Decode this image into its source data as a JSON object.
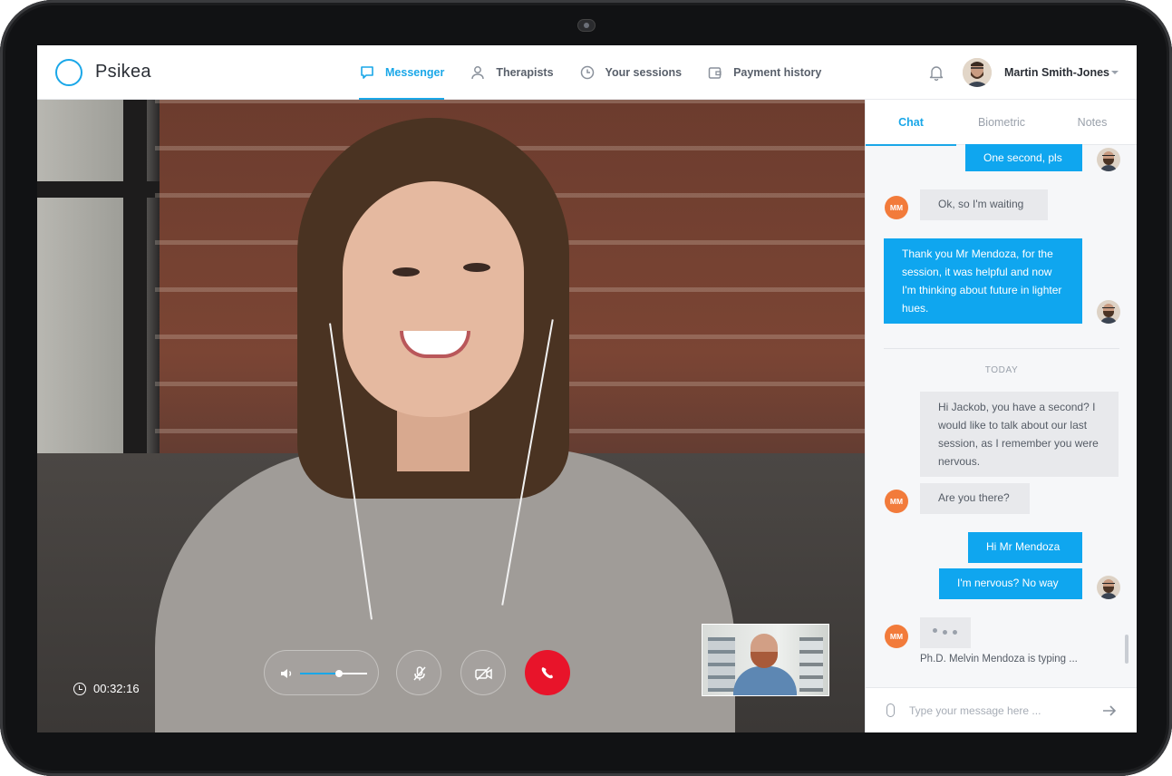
{
  "app": {
    "name": "Psikea"
  },
  "nav": {
    "items": [
      {
        "label": "Messenger",
        "icon": "chat-icon",
        "active": true
      },
      {
        "label": "Therapists",
        "icon": "user-icon",
        "active": false
      },
      {
        "label": "Your sessions",
        "icon": "clock-icon",
        "active": false
      },
      {
        "label": "Payment history",
        "icon": "wallet-icon",
        "active": false
      }
    ]
  },
  "user": {
    "name": "Martin Smith-Jones"
  },
  "call": {
    "timer": "00:32:16",
    "volume_level": 0.58
  },
  "panel": {
    "tabs": [
      "Chat",
      "Biometric",
      "Notes"
    ],
    "active_tab": "Chat",
    "messages": [
      {
        "from": "me",
        "text": "One second, pls"
      },
      {
        "from": "therapist",
        "avatar": "MM",
        "text": "Ok, so I'm waiting"
      },
      {
        "from": "me",
        "text": "Thank you Mr Mendoza, for the session, it was helpful and now I'm thinking about future in lighter hues."
      },
      {
        "from": "therapist",
        "avatar": "MM",
        "text": "Hi Jackob, you have a second? I would like to talk about our last session, as I remember you were nervous."
      },
      {
        "from": "therapist",
        "avatar": "MM",
        "text": "Are you there?"
      },
      {
        "from": "me",
        "text": "Hi Mr Mendoza"
      },
      {
        "from": "me",
        "text": "I'm nervous? No way"
      }
    ],
    "day_separator": "TODAY",
    "typing_indicator": "Ph.D. Melvin Mendoza is typing ...",
    "therapist_initials": "MM",
    "composer": {
      "placeholder": "Type your message here ..."
    }
  },
  "colors": {
    "accent": "#1aa7e8",
    "end_call": "#e8142a",
    "therapist_avatar": "#f27b3b"
  }
}
